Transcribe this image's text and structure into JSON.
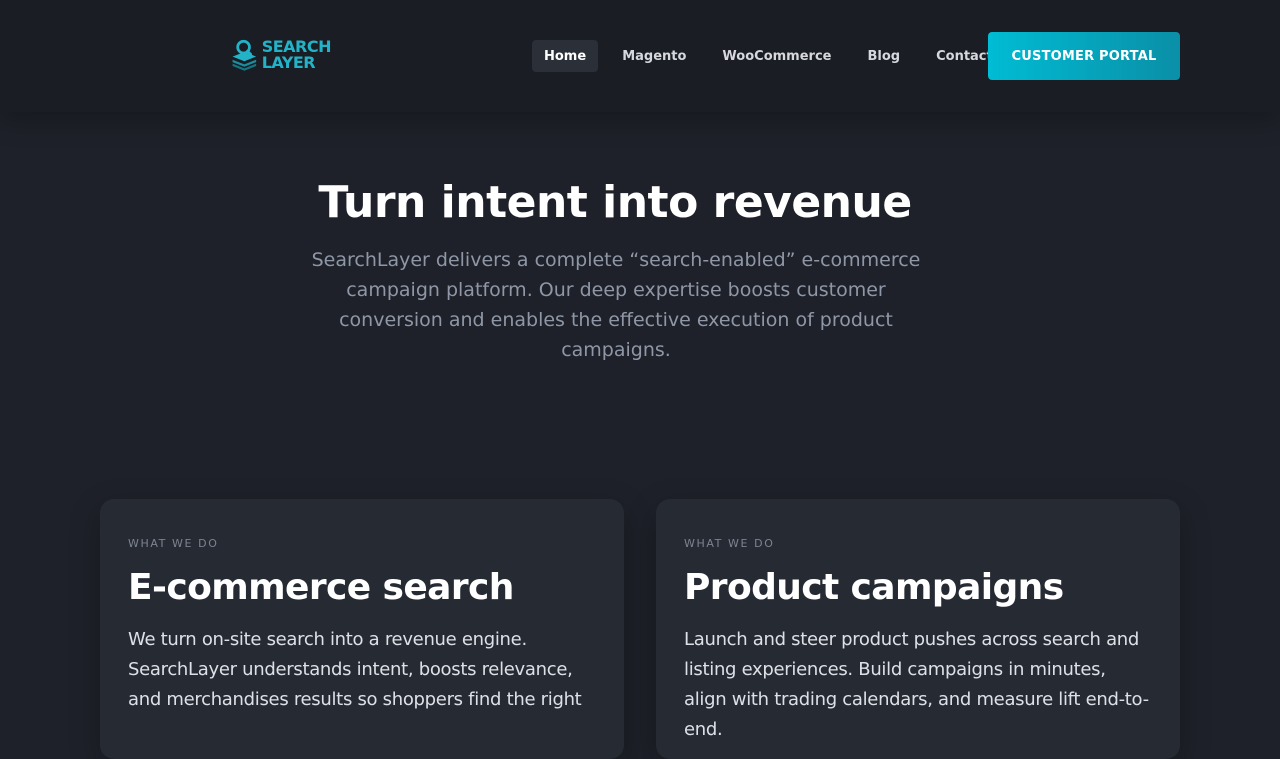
{
  "header": {
    "logo": {
      "line1": "SEARCH",
      "line2": "LAYER",
      "icon": "search-layers-logo-icon",
      "color": "#23b3c8"
    },
    "nav": [
      {
        "label": "Home",
        "active": true
      },
      {
        "label": "Magento",
        "active": false
      },
      {
        "label": "WooCommerce",
        "active": false
      },
      {
        "label": "Blog",
        "active": false
      },
      {
        "label": "Contact",
        "active": false
      }
    ],
    "cta_label": "CUSTOMER PORTAL",
    "cta_color": "#00bcd4"
  },
  "hero": {
    "title": "Turn intent into revenue",
    "subtitle": "SearchLayer delivers a complete “search-enabled” e-commerce campaign platform. Our deep expertise boosts customer conversion and enables the effective execution of product campaigns."
  },
  "cards": [
    {
      "eyebrow": "WHAT WE DO",
      "title": "E-commerce search",
      "body": "We turn on-site search into a revenue engine. SearchLayer understands intent, boosts relevance, and merchandises results so shoppers find the right"
    },
    {
      "eyebrow": "WHAT WE DO",
      "title": "Product campaigns",
      "body": "Launch and steer product pushes across search and listing experiences. Build campaigns in minutes, align with trading calendars, and measure lift end-to-end."
    }
  ],
  "colors": {
    "background": "#1e2129",
    "header": "#1a1d23",
    "card": "#262a33",
    "accent": "#00bcd4"
  }
}
